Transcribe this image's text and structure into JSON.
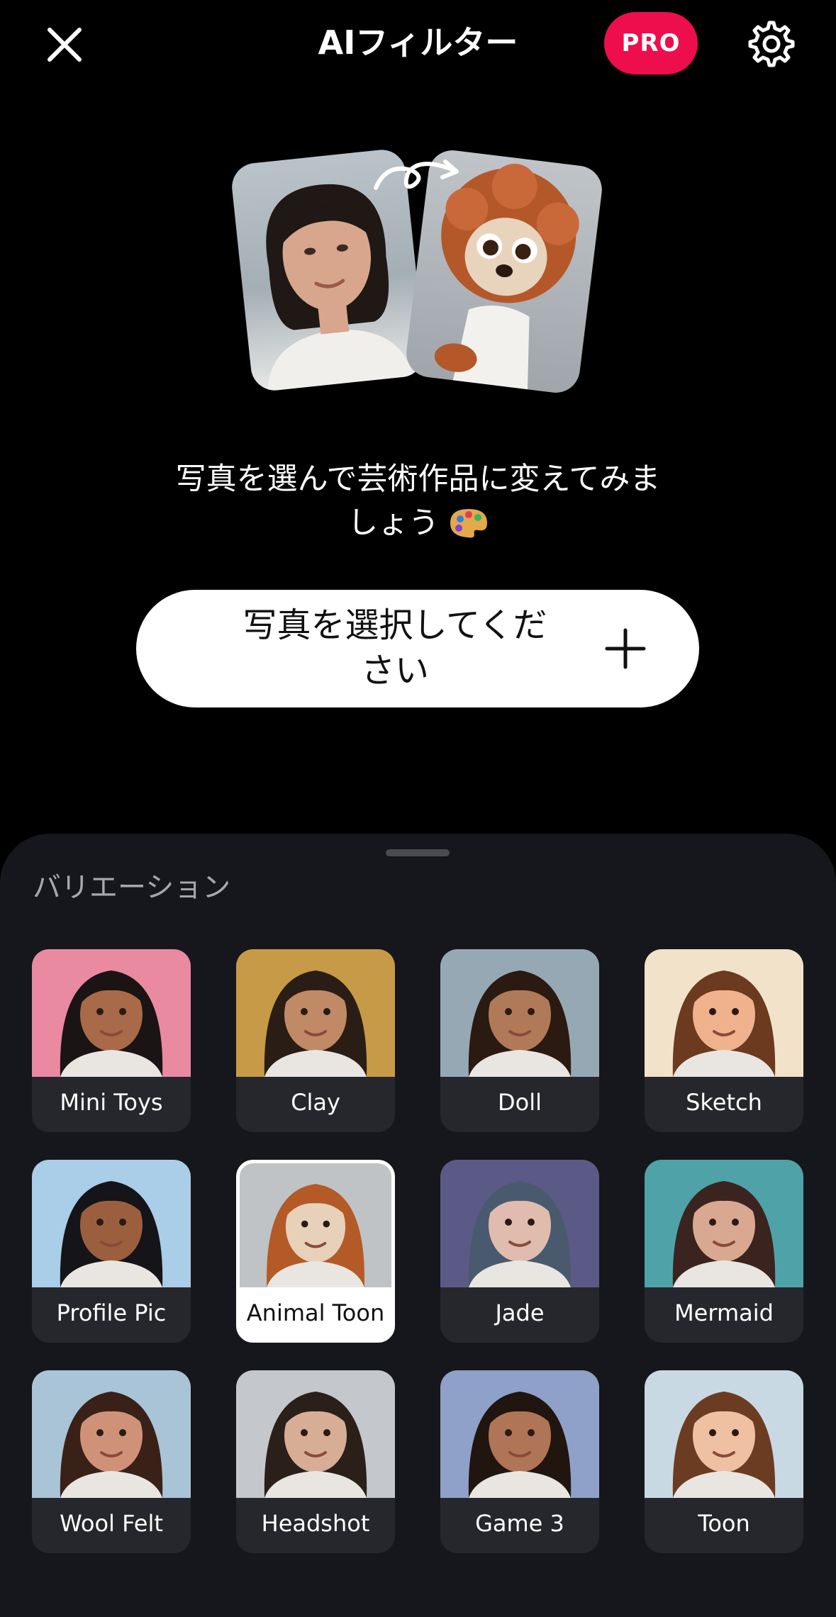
{
  "header": {
    "title": "AIフィルター",
    "pro_badge": "PRO",
    "icons": {
      "close": "close-icon",
      "settings": "gear-icon"
    }
  },
  "hero": {
    "prompt_line1": "写真を選んで芸術作品に変えてみま",
    "prompt_line2": "しょう"
  },
  "select_button": {
    "label_line1": "写真を選択してくだ",
    "label_line2": "さい"
  },
  "variations": {
    "title": "バリエーション",
    "items": [
      {
        "label": "Mini Toys",
        "bg": "#e98aa0",
        "skin": "#a86a48",
        "hair": "#1a1414"
      },
      {
        "label": "Clay",
        "bg": "#c79a47",
        "skin": "#c08a66",
        "hair": "#2a1d15"
      },
      {
        "label": "Doll",
        "bg": "#97a8b5",
        "skin": "#b07a58",
        "hair": "#2a1a12"
      },
      {
        "label": "Sketch",
        "bg": "#f2e2c9",
        "skin": "#f0b28c",
        "hair": "#6b3a1f"
      },
      {
        "label": "Profile Pic",
        "bg": "#aacde8",
        "skin": "#9b5f3f",
        "hair": "#141419"
      },
      {
        "label": "Animal Toon",
        "bg": "#bfc3c6",
        "skin": "#e7d1bb",
        "hair": "#b45a26",
        "selected": true
      },
      {
        "label": "Jade",
        "bg": "#5b5a86",
        "skin": "#e0bcae",
        "hair": "#4a5a6e"
      },
      {
        "label": "Mermaid",
        "bg": "#4fa3a8",
        "skin": "#d9a891",
        "hair": "#3b2320"
      },
      {
        "label": "Wool Felt",
        "bg": "#a9c4d6",
        "skin": "#cf9279",
        "hair": "#3a2118"
      },
      {
        "label": "Headshot",
        "bg": "#c4c7cb",
        "skin": "#d8ad95",
        "hair": "#2b1f1a"
      },
      {
        "label": "Game 3",
        "bg": "#8fa1c8",
        "skin": "#b07456",
        "hair": "#21150f"
      },
      {
        "label": "Toon",
        "bg": "#c9d9e4",
        "skin": "#efc0a1",
        "hair": "#6c3c22"
      }
    ]
  },
  "colors": {
    "accent": "#ee0d4d",
    "sheet_bg": "#16171c",
    "tile_bg": "#26272c"
  }
}
